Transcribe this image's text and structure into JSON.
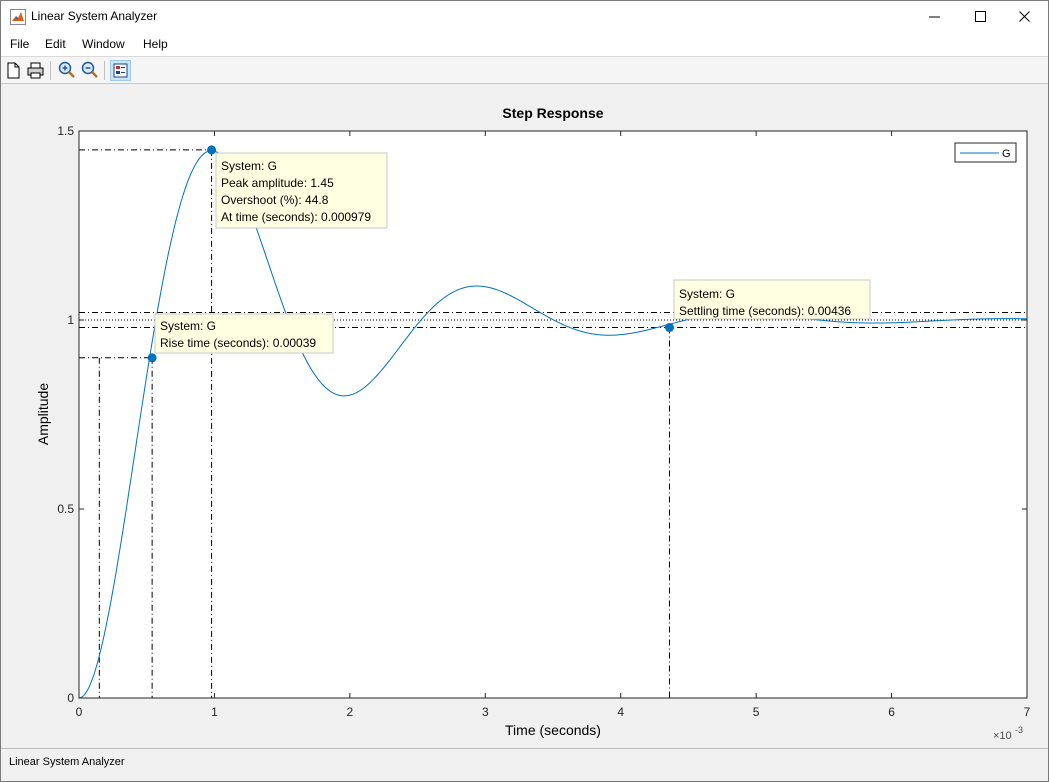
{
  "window": {
    "title": "Linear System Analyzer"
  },
  "menu": {
    "items": [
      {
        "label": "File"
      },
      {
        "label": "Edit"
      },
      {
        "label": "Window"
      },
      {
        "label": "Help"
      }
    ]
  },
  "toolbar": {
    "buttons": [
      {
        "icon": "new-document-icon"
      },
      {
        "icon": "print-icon"
      },
      {
        "icon": "zoom-in-icon"
      },
      {
        "icon": "zoom-out-icon"
      },
      {
        "icon": "plot-configurations-icon"
      }
    ]
  },
  "status": {
    "text": "Linear System Analyzer"
  },
  "colors": {
    "line": "#0072bd",
    "tooltip_bg": "#ffffe1"
  },
  "chart_data": {
    "type": "line",
    "title": "Step Response",
    "xlabel": "Time (seconds)",
    "ylabel": "Amplitude",
    "x_exponent": "×10^-3",
    "x_exponent_base": "×10",
    "x_exponent_power": "-3",
    "xlim": [
      0,
      0.007
    ],
    "ylim": [
      0,
      1.5
    ],
    "xticks": [
      0,
      0.001,
      0.002,
      0.003,
      0.004,
      0.005,
      0.006,
      0.007
    ],
    "xtick_labels": [
      "0",
      "1",
      "2",
      "3",
      "4",
      "5",
      "6",
      "7"
    ],
    "yticks": [
      0,
      0.5,
      1,
      1.5
    ],
    "ytick_labels": [
      "0",
      "0.5",
      "1",
      "1.5"
    ],
    "legend": {
      "entries": [
        "G"
      ],
      "position": "top-right"
    },
    "series": [
      {
        "name": "G",
        "final_value": 1,
        "peak_amplitude": 1.45,
        "peak_time": 0.000979,
        "overshoot_pct": 44.8,
        "rise_time": 0.00039,
        "settling_time": 0.00436
      }
    ],
    "markers": [
      {
        "x": 0.000979,
        "y": 1.45
      },
      {
        "x": 0.00054,
        "y": 0.9
      },
      {
        "x": 0.00436,
        "y": 0.98
      }
    ],
    "reference_lines": {
      "settling_band": [
        0.98,
        1.02
      ],
      "rise_levels": [
        0.1,
        0.9
      ],
      "rise_start_time": 0.00015
    },
    "annotations": [
      {
        "lines": [
          "System: G",
          "Peak amplitude: 1.45",
          "Overshoot (%): 44.8",
          "At time (seconds): 0.000979"
        ]
      },
      {
        "lines": [
          "System: G",
          "Rise time (seconds): 0.00039"
        ]
      },
      {
        "lines": [
          "System: G",
          "Settling time (seconds): 0.00436"
        ]
      }
    ]
  }
}
